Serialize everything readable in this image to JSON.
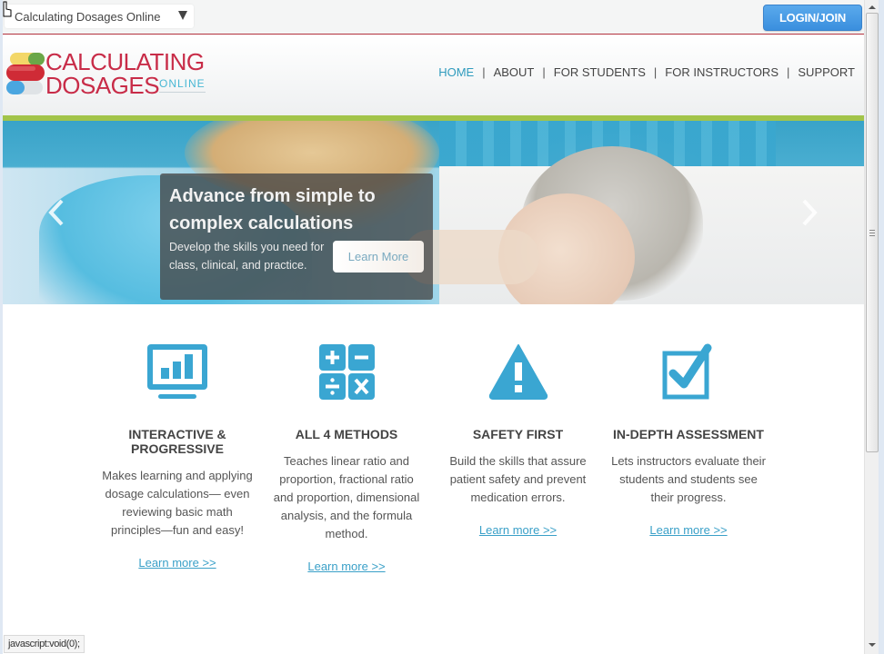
{
  "topbar": {
    "site_select": {
      "value": "Calculating Dosages Online"
    },
    "login_label": "LOGIN/JOIN"
  },
  "header": {
    "logo": {
      "line1": "CALCULATING",
      "line2": "DOSAGES",
      "online": "ONLINE"
    },
    "nav": [
      {
        "label": "HOME",
        "active": true
      },
      {
        "label": "ABOUT"
      },
      {
        "label": "FOR STUDENTS"
      },
      {
        "label": "FOR INSTRUCTORS"
      },
      {
        "label": "SUPPORT"
      }
    ],
    "nav_separator": "|"
  },
  "hero": {
    "caption_title": "Advance from simple to complex calculations",
    "caption_body": "Develop the skills you need for class, clinical, and practice.",
    "caption_button": "Learn More",
    "prev_icon": "chevron-left-icon",
    "next_icon": "chevron-right-icon"
  },
  "features": [
    {
      "icon": "monitor-chart-icon",
      "title": "INTERACTIVE & PROGRESSIVE",
      "body": "Makes learning and applying dosage calculations— even reviewing basic math principles—fun and easy!",
      "link": "Learn more >>"
    },
    {
      "icon": "math-operators-icon",
      "title": "ALL 4 METHODS",
      "body": "Teaches linear ratio and proportion, fractional ratio and proportion, dimensional analysis, and the formula method.",
      "link": "Learn more >>"
    },
    {
      "icon": "warning-triangle-icon",
      "title": "SAFETY FIRST",
      "body": "Build the skills that assure patient safety and prevent medication errors.",
      "link": "Learn more >>"
    },
    {
      "icon": "checkbox-checked-icon",
      "title": "IN-DEPTH ASSESSMENT",
      "body": "Lets instructors evaluate their students and students see their progress.",
      "link": "Learn more >>"
    }
  ],
  "statusbar": {
    "text": "javascript:void(0);"
  },
  "colors": {
    "accent_blue": "#3aa6d2",
    "brand_red": "#c82c48",
    "nav_active": "#2f9bbd",
    "green_bar": "#a2c44a",
    "login_button": "#4a9de6"
  }
}
